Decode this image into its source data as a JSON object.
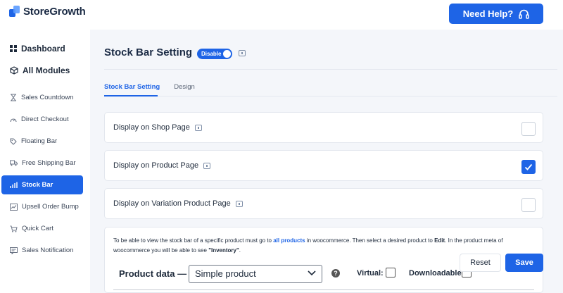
{
  "app": {
    "brand_name": "StoreGrowth",
    "help_button_label": "Need Help?"
  },
  "colors": {
    "accent": "#1e64e6",
    "sidebar_bg": "#ffffff",
    "page_bg": "#f4f6fa"
  },
  "sidebar": {
    "dashboard_label": "Dashboard",
    "all_modules_label": "All Modules",
    "items": [
      {
        "label": "Sales Countdown",
        "icon": "hourglass-icon",
        "active": false
      },
      {
        "label": "Direct Checkout",
        "icon": "gauge-icon",
        "active": false
      },
      {
        "label": "Floating Bar",
        "icon": "tag-icon",
        "active": false
      },
      {
        "label": "Free Shipping Bar",
        "icon": "truck-icon",
        "active": false
      },
      {
        "label": "Stock Bar",
        "icon": "bar-chart-icon",
        "active": true
      },
      {
        "label": "Upsell Order Bump",
        "icon": "trend-up-icon",
        "active": false
      },
      {
        "label": "Quick Cart",
        "icon": "cart-icon",
        "active": false
      },
      {
        "label": "Sales Notification",
        "icon": "notification-icon",
        "active": false
      }
    ]
  },
  "page": {
    "title": "Stock Bar Setting",
    "toggle_label": "Disable",
    "tabs": [
      {
        "label": "Stock Bar Setting",
        "active": true
      },
      {
        "label": "Design",
        "active": false
      }
    ]
  },
  "settings": [
    {
      "label": "Display on Shop Page",
      "checked": false
    },
    {
      "label": "Display on Product Page",
      "checked": true
    },
    {
      "label": "Display on Variation Product Page",
      "checked": false
    }
  ],
  "description": {
    "part1": "To be able to view the stock bar of a specific product must go to ",
    "link": "all products",
    "part2": " in woocommerce. Then select a desired product to ",
    "bold1": "Edit",
    "part3": ". In the product meta of woocommerce you will be able to see ",
    "bold2": "\"Inventory\"",
    "part4": "."
  },
  "product_data": {
    "label": "Product data —",
    "select_value": "Simple product",
    "virtual_label": "Virtual:",
    "virtual_checked": false,
    "downloadable_label": "Downloadable:",
    "downloadable_checked": false
  },
  "actions": {
    "reset_label": "Reset",
    "save_label": "Save"
  }
}
